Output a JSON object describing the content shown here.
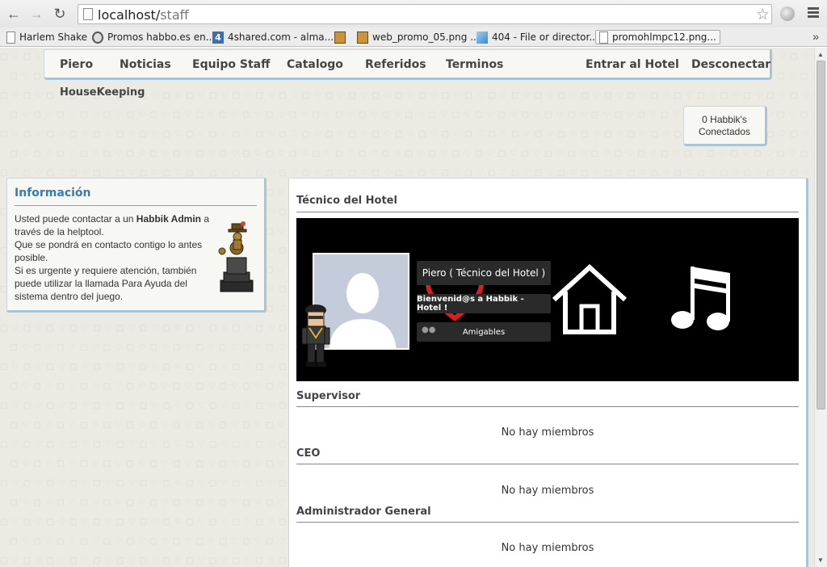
{
  "browser": {
    "url_host": "localhost/",
    "url_path": "staff",
    "bookmarks": [
      {
        "label": "Harlem Shake"
      },
      {
        "label": "Promos habbo.es en..."
      },
      {
        "label": "4shared.com - alma..."
      },
      {
        "label": "web_promo_05.png ..."
      },
      {
        "label": "404 - File or director..."
      },
      {
        "label": "promohlmpc12.png..."
      }
    ]
  },
  "nav": {
    "items": [
      "Piero",
      "Noticias",
      "Equipo Staff",
      "Catalogo",
      "Referidos",
      "Terminos"
    ],
    "right_items": [
      "Entrar al Hotel",
      "Desconectar"
    ],
    "sub_item": "HouseKeeping"
  },
  "online": {
    "line1": "0 Habbik's",
    "line2": "Conectados"
  },
  "info": {
    "title": "Información",
    "p1_pre": "Usted puede contactar a un ",
    "p1_bold": "Habbik Admin",
    "p1_post": " a través de la helptool.",
    "p2": "Que se pondrá en contacto contigo lo antes posible.",
    "p3": "Si es urgente y requiere atención, también puede utilizar la llamada Para Ayuda del sistema dentro del juego."
  },
  "main": {
    "sections": [
      {
        "title": "Técnico del Hotel"
      },
      {
        "title": "Supervisor",
        "empty": "No hay miembros"
      },
      {
        "title": "CEO",
        "empty": "No hay miembros"
      },
      {
        "title": "Administrador General",
        "empty": "No hay miembros"
      }
    ],
    "card": {
      "name": "Piero ( Técnico del Hotel )",
      "motto": "Bienvenid@s a Habbik - Hotel !",
      "friends_label": "Amigables"
    }
  },
  "colors": {
    "accent": "#3a7bb0",
    "panel_border": "#a9c4d6",
    "card_bg": "#000000",
    "heart": "#d42020"
  }
}
